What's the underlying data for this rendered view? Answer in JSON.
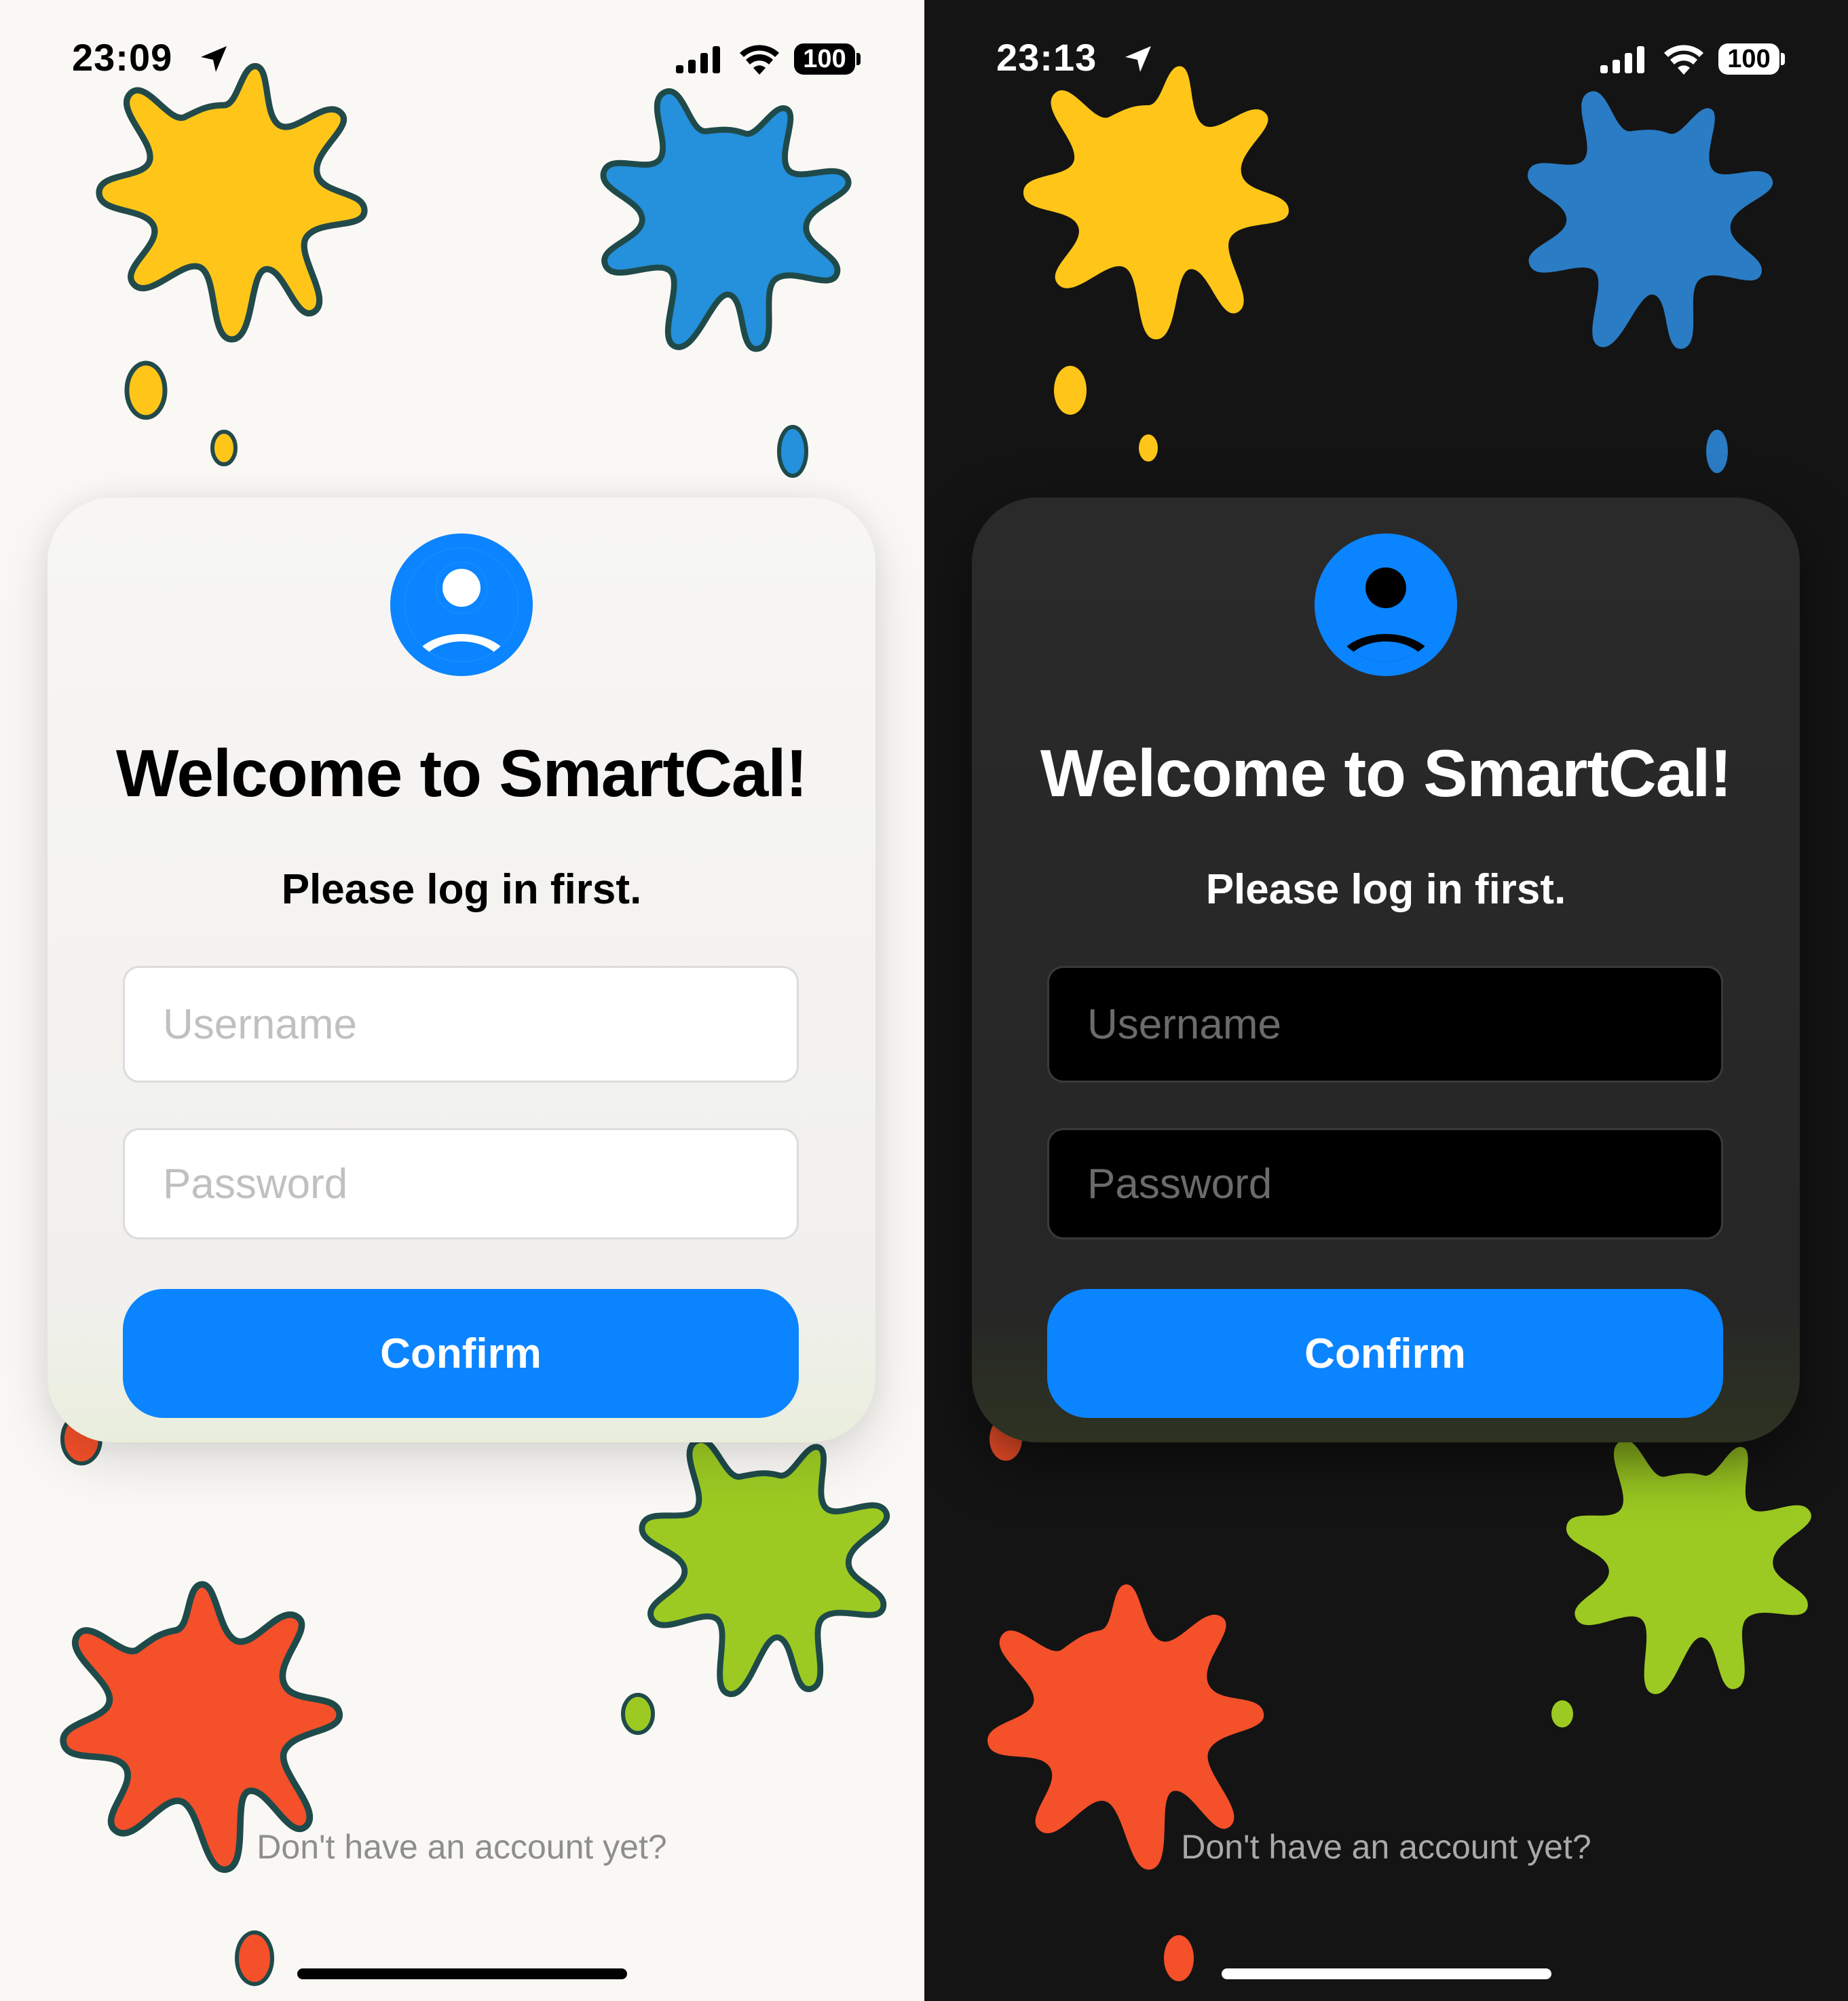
{
  "screens": [
    {
      "theme": "light",
      "status_bar": {
        "time": "23:09",
        "battery": "100"
      },
      "card": {
        "title": "Welcome to SmartCal!",
        "subtitle": "Please log in first.",
        "username_placeholder": "Username",
        "password_placeholder": "Password",
        "confirm_label": "Confirm"
      },
      "signup_link": "Don't have an account yet?"
    },
    {
      "theme": "dark",
      "status_bar": {
        "time": "23:13",
        "battery": "100"
      },
      "card": {
        "title": "Welcome to SmartCal!",
        "subtitle": "Please log in first.",
        "username_placeholder": "Username",
        "password_placeholder": "Password",
        "confirm_label": "Confirm"
      },
      "signup_link": "Don't have an account yet?"
    }
  ],
  "icons": {
    "avatar": "person-circle-icon",
    "location": "location-arrow-icon",
    "signal": "cellular-signal-icon",
    "wifi": "wifi-icon",
    "battery": "battery-icon"
  },
  "colors": {
    "accent": "#0b84ff",
    "light_background": "#faf8f5",
    "dark_background": "#141414",
    "splash_yellow": "#ffc619",
    "splash_blue": "#2590dc",
    "splash_red": "#f4502a",
    "splash_green": "#9cca22"
  }
}
